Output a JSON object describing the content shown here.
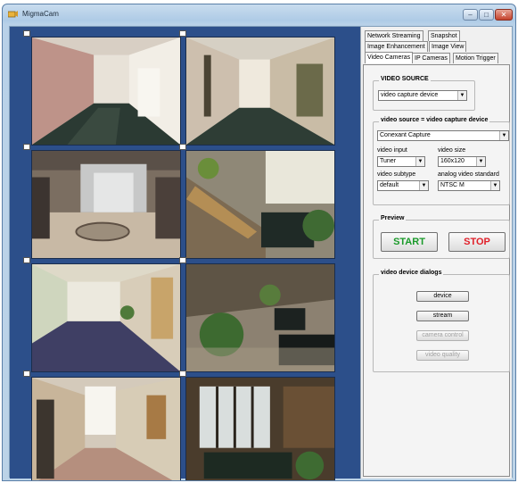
{
  "window": {
    "title": "MigmaCam",
    "minimize_glyph": "–",
    "maximize_glyph": "□",
    "close_glyph": "✕"
  },
  "tabs": {
    "row1": [
      "Network Streaming",
      "Snapshot"
    ],
    "row2": [
      "Image Enhancement",
      "Image View"
    ],
    "row3": [
      "Video Cameras",
      "IP Cameras",
      "Motion Trigger"
    ],
    "active": "Video Cameras"
  },
  "video_source": {
    "legend": "VIDEO SOURCE",
    "value": "video capture device"
  },
  "device": {
    "legend": "video source = video capture device",
    "device_value": "Conexant Capture",
    "video_input_label": "video input",
    "video_input_value": "Tuner",
    "video_size_label": "video size",
    "video_size_value": "160x120",
    "video_subtype_label": "video subtype",
    "video_subtype_value": "default",
    "analog_standard_label": "analog video standard",
    "analog_standard_value": "NTSC M"
  },
  "preview": {
    "legend": "Preview",
    "start_label": "START",
    "stop_label": "STOP",
    "start_color": "#1a9a2a",
    "stop_color": "#e0202a"
  },
  "dialogs": {
    "legend": "video device dialogs",
    "device_label": "device",
    "stream_label": "stream",
    "camera_control_label": "camera control",
    "video_quality_label": "video quality"
  },
  "cameras": [
    "camera-1",
    "camera-2",
    "camera-3",
    "camera-4",
    "camera-5",
    "camera-6",
    "camera-7",
    "camera-8"
  ],
  "colors": {
    "camera_background": "#2c4f8a",
    "window_frame": "#aecbe6"
  }
}
